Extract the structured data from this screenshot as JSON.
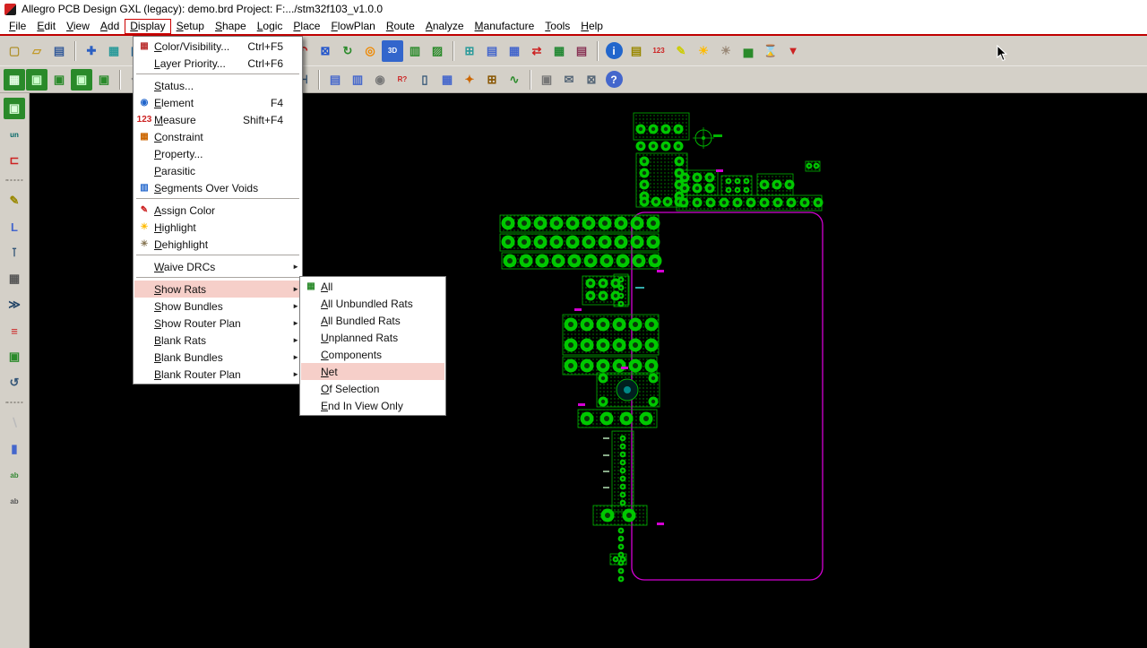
{
  "window": {
    "title": "Allegro PCB Design GXL (legacy): demo.brd  Project: F:.../stm32f103_v1.0.0"
  },
  "menubar": {
    "items": [
      {
        "label": "File",
        "name": "menu-file"
      },
      {
        "label": "Edit",
        "name": "menu-edit"
      },
      {
        "label": "View",
        "name": "menu-view"
      },
      {
        "label": "Add",
        "name": "menu-add"
      },
      {
        "label": "Display",
        "name": "menu-display",
        "cls": "active"
      },
      {
        "label": "Setup",
        "name": "menu-setup"
      },
      {
        "label": "Shape",
        "name": "menu-shape"
      },
      {
        "label": "Logic",
        "name": "menu-logic"
      },
      {
        "label": "Place",
        "name": "menu-place"
      },
      {
        "label": "FlowPlan",
        "name": "menu-flowplan"
      },
      {
        "label": "Route",
        "name": "menu-route"
      },
      {
        "label": "Analyze",
        "name": "menu-analyze"
      },
      {
        "label": "Manufacture",
        "name": "menu-manufacture"
      },
      {
        "label": "Tools",
        "name": "menu-tools"
      },
      {
        "label": "Help",
        "name": "menu-help"
      }
    ]
  },
  "toolbar_main": {
    "icons": [
      {
        "name": "new-icon",
        "glyph": "▢",
        "fg": "#b0922f"
      },
      {
        "name": "open-folder-icon",
        "glyph": "▱",
        "fg": "#c29a2a"
      },
      {
        "name": "save-icon",
        "glyph": "▤",
        "fg": "#335a99"
      },
      {
        "name": "toolbar-separator",
        "cls": "sep"
      },
      {
        "name": "move-icon",
        "glyph": "✚",
        "fg": "#2b5fc2"
      },
      {
        "name": "show-rats-icon",
        "glyph": "▦",
        "fg": "#2a9a9a"
      },
      {
        "name": "shadow-toggle-icon",
        "glyph": "◫",
        "fg": "#2a6a9a"
      },
      {
        "name": "blank-rats-icon",
        "glyph": "▩",
        "fg": "#777777"
      },
      {
        "name": "toolbar-separator",
        "cls": "sep"
      },
      {
        "name": "zoom-points-icon",
        "glyph": "⊙",
        "fg": "#2255cc"
      },
      {
        "name": "zoom-fit-icon",
        "glyph": "⊡",
        "fg": "#2255cc"
      },
      {
        "name": "zoom-in-icon",
        "glyph": "⊕",
        "fg": "#2255cc"
      },
      {
        "name": "zoom-out-icon",
        "glyph": "⊖",
        "fg": "#2255cc"
      },
      {
        "name": "zoom-world-icon",
        "glyph": "◎",
        "fg": "#2255cc"
      },
      {
        "name": "zoom-previous-icon",
        "glyph": "↶",
        "fg": "#cc2222"
      },
      {
        "name": "zoom-selection-icon",
        "glyph": "⊠",
        "fg": "#2255cc"
      },
      {
        "name": "redraw-icon",
        "glyph": "↻",
        "fg": "#2a8a2a"
      },
      {
        "name": "target-icon",
        "glyph": "◎",
        "fg": "#ee8800"
      },
      {
        "name": "3d-view-icon",
        "glyph": "3D",
        "fg": "#ffffff",
        "bg": "#3366cc",
        "cls": "small"
      },
      {
        "name": "film-icon",
        "glyph": "▥",
        "fg": "#2a8a2a"
      },
      {
        "name": "artwork-icon",
        "glyph": "▨",
        "fg": "#2a8a2a"
      },
      {
        "name": "toolbar-separator",
        "cls": "sep"
      },
      {
        "name": "grid-icon",
        "glyph": "⊞",
        "fg": "#2a9a9a"
      },
      {
        "name": "property-icon",
        "glyph": "▤",
        "fg": "#4466cc"
      },
      {
        "name": "constraint-manager-icon",
        "glyph": "▦",
        "fg": "#4466cc"
      },
      {
        "name": "swap-icon",
        "glyph": "⇄",
        "fg": "#cc2222"
      },
      {
        "name": "spreadsheet-icon",
        "glyph": "▦",
        "fg": "#228833"
      },
      {
        "name": "cross-section-icon",
        "glyph": "▤",
        "fg": "#883355"
      },
      {
        "name": "toolbar-separator",
        "cls": "sep"
      },
      {
        "name": "info-icon",
        "glyph": "i",
        "fg": "#ffffff",
        "bg": "#2266cc",
        "cls": "round"
      },
      {
        "name": "report-icon",
        "glyph": "▤",
        "fg": "#998800"
      },
      {
        "name": "measure-123-icon",
        "glyph": "123",
        "fg": "#cc2222",
        "cls": "small"
      },
      {
        "name": "highlight-pen-icon",
        "glyph": "✎",
        "fg": "#cccc00"
      },
      {
        "name": "highlight-icon",
        "glyph": "☀",
        "fg": "#ffbb00"
      },
      {
        "name": "dehighlight-icon",
        "glyph": "☀",
        "fg": "#998877"
      },
      {
        "name": "bar-chart-icon",
        "glyph": "▅",
        "fg": "#2a8a2a"
      },
      {
        "name": "hourglass-icon",
        "glyph": "⌛",
        "fg": "#2a9a9a"
      },
      {
        "name": "filter-rats-icon",
        "glyph": "▼",
        "fg": "#cc2222"
      }
    ]
  },
  "toolbar_secondary": {
    "icons": [
      {
        "name": "color192-icon",
        "glyph": "▦",
        "fg": "#e6ffe6",
        "bg": "#2a8a2a"
      },
      {
        "name": "visibility-save1-icon",
        "glyph": "▣",
        "fg": "#ccffcc",
        "bg": "#2a8a2a"
      },
      {
        "name": "visibility-save2-icon",
        "glyph": "▣",
        "fg": "#2a8a2a"
      },
      {
        "name": "visibility-save3-icon",
        "glyph": "▣",
        "fg": "#ccffcc",
        "bg": "#2a8a2a"
      },
      {
        "name": "visibility-save4-icon",
        "glyph": "▣",
        "fg": "#2a8a2a"
      },
      {
        "name": "toolbar-separator",
        "cls": "sep"
      },
      {
        "name": "prev-shape-icon",
        "glyph": "↶",
        "fg": "#888888"
      },
      {
        "name": "rect-shape-icon",
        "glyph": "▭",
        "fg": "#888888"
      },
      {
        "name": "circle-shape-icon",
        "glyph": "◯",
        "fg": "#888888"
      },
      {
        "name": "poly-shape-icon",
        "glyph": "▱",
        "fg": "#888888"
      },
      {
        "name": "delete-icon",
        "glyph": "✖",
        "fg": "#cc2222"
      },
      {
        "name": "toolbar-separator",
        "cls": "sep"
      },
      {
        "name": "component-icon",
        "glyph": "▣",
        "fg": "#ddffdd",
        "bg": "#2a8a2a"
      },
      {
        "name": "dim-horizontal-icon",
        "glyph": "⊢",
        "fg": "#335577"
      },
      {
        "name": "dim-vertical-icon",
        "glyph": "⊣",
        "fg": "#335577"
      },
      {
        "name": "toolbar-separator",
        "cls": "sep"
      },
      {
        "name": "film-record-icon",
        "glyph": "▤",
        "fg": "#4466cc"
      },
      {
        "name": "module-icon",
        "glyph": "▥",
        "fg": "#4466cc"
      },
      {
        "name": "probe-icon",
        "glyph": "◉",
        "fg": "#777777"
      },
      {
        "name": "refdes-icon",
        "glyph": "R?",
        "fg": "#cc2222",
        "cls": "small"
      },
      {
        "name": "panel-icon",
        "glyph": "▯",
        "fg": "#335577"
      },
      {
        "name": "checker-icon",
        "glyph": "▦",
        "fg": "#4466cc"
      },
      {
        "name": "glue-icon",
        "glyph": "✦",
        "fg": "#cc6600"
      },
      {
        "name": "snap-grid-icon",
        "glyph": "⊞",
        "fg": "#885500"
      },
      {
        "name": "waveform-icon",
        "glyph": "∿",
        "fg": "#2a8a2a"
      },
      {
        "name": "toolbar-separator",
        "cls": "sep"
      },
      {
        "name": "copy-view-icon",
        "glyph": "▣",
        "fg": "#777777"
      },
      {
        "name": "mail-send-icon",
        "glyph": "✉",
        "fg": "#556677"
      },
      {
        "name": "mail-x-icon",
        "glyph": "⊠",
        "fg": "#556677"
      },
      {
        "name": "help-icon",
        "glyph": "?",
        "fg": "#ffffff",
        "bg": "#4466cc",
        "cls": "round"
      }
    ]
  },
  "sidebar": {
    "icons": [
      {
        "name": "visibility-board-icon",
        "glyph": "▣",
        "fg": "#ddffdd",
        "bg": "#2a8a2a"
      },
      {
        "name": "unrats-icon",
        "glyph": "un",
        "fg": "#006666",
        "cls": "small"
      },
      {
        "name": "connector-icon",
        "glyph": "⊏",
        "fg": "#cc2222"
      },
      {
        "name": "sidebar-grip",
        "cls": "grip"
      },
      {
        "name": "pencil-tool-icon",
        "glyph": "✎",
        "fg": "#998800"
      },
      {
        "name": "label-tool-icon",
        "glyph": "L",
        "fg": "#4466cc"
      },
      {
        "name": "pin-tool-icon",
        "glyph": "⊺",
        "fg": "#335577"
      },
      {
        "name": "crop-tool-icon",
        "glyph": "▦",
        "fg": "#555555"
      },
      {
        "name": "fast-forward-icon",
        "glyph": "≫",
        "fg": "#224466"
      },
      {
        "name": "etch-edit-icon",
        "glyph": "≡",
        "fg": "#cc2222"
      },
      {
        "name": "board-small-icon",
        "glyph": "▣",
        "fg": "#2a8a2a"
      },
      {
        "name": "rotate-icon",
        "glyph": "↺",
        "fg": "#335577"
      },
      {
        "name": "sidebar-grip",
        "cls": "grip"
      },
      {
        "name": "line-tool-icon",
        "glyph": "∖",
        "fg": "#bbbbbb"
      },
      {
        "name": "rect-tool-icon",
        "glyph": "▮",
        "fg": "#4466cc"
      },
      {
        "name": "add-text-icon",
        "glyph": "ab",
        "fg": "#338833",
        "cls": "small"
      },
      {
        "name": "edit-text-icon",
        "glyph": "ab",
        "fg": "#555555",
        "cls": "small"
      }
    ]
  },
  "display_menu": {
    "items": [
      {
        "name": "menu-item-color-visibility",
        "label": "Color/Visibility...",
        "shortcut": "Ctrl+F5",
        "glyph": "▦",
        "fg": "#bb3333"
      },
      {
        "name": "menu-item-layer-priority",
        "label": "Layer Priority...",
        "shortcut": "Ctrl+F6"
      },
      {
        "name": "menu-separator",
        "cls": "sep"
      },
      {
        "name": "menu-item-status",
        "label": "Status..."
      },
      {
        "name": "menu-item-element",
        "label": "Element",
        "shortcut": "F4",
        "glyph": "◉",
        "fg": "#2266cc"
      },
      {
        "name": "menu-item-measure",
        "label": "Measure",
        "shortcut": "Shift+F4",
        "glyph": "123",
        "fg": "#cc2222"
      },
      {
        "name": "menu-item-constraint",
        "label": "Constraint",
        "glyph": "▦",
        "fg": "#cc6600"
      },
      {
        "name": "menu-item-property",
        "label": "Property..."
      },
      {
        "name": "menu-item-parasitic",
        "label": "Parasitic"
      },
      {
        "name": "menu-item-segments-over-voids",
        "label": "Segments Over Voids",
        "glyph": "▥",
        "fg": "#2266cc"
      },
      {
        "name": "menu-separator",
        "cls": "sep"
      },
      {
        "name": "menu-item-assign-color",
        "label": "Assign Color",
        "glyph": "✎",
        "fg": "#cc2222"
      },
      {
        "name": "menu-item-highlight",
        "label": "Highlight",
        "glyph": "☀",
        "fg": "#ffbb00"
      },
      {
        "name": "menu-item-dehighlight",
        "label": "Dehighlight",
        "glyph": "☀",
        "fg": "#887755"
      },
      {
        "name": "menu-separator",
        "cls": "sep"
      },
      {
        "name": "menu-item-waive-drcs",
        "label": "Waive DRCs",
        "arrow": "►"
      },
      {
        "name": "menu-separator",
        "cls": "sep"
      },
      {
        "name": "menu-item-show-rats",
        "label": "Show Rats",
        "arrow": "►",
        "cls": "hl"
      },
      {
        "name": "menu-item-show-bundles",
        "label": "Show Bundles",
        "arrow": "►"
      },
      {
        "name": "menu-item-show-router-plan",
        "label": "Show Router Plan",
        "arrow": "►"
      },
      {
        "name": "menu-item-blank-rats",
        "label": "Blank Rats",
        "arrow": "►"
      },
      {
        "name": "menu-item-blank-bundles",
        "label": "Blank Bundles",
        "arrow": "►"
      },
      {
        "name": "menu-item-blank-router-plan",
        "label": "Blank Router Plan",
        "arrow": "►"
      }
    ]
  },
  "show_rats_submenu": {
    "items": [
      {
        "name": "menu-item-rats-all",
        "label": "All",
        "glyph": "▦",
        "fg": "#2a8a2a"
      },
      {
        "name": "menu-item-rats-all-unbundled",
        "label": "All Unbundled Rats"
      },
      {
        "name": "menu-item-rats-all-bundled",
        "label": "All Bundled Rats"
      },
      {
        "name": "menu-item-rats-unplanned",
        "label": "Unplanned Rats"
      },
      {
        "name": "menu-item-rats-components",
        "label": "Components"
      },
      {
        "name": "menu-item-rats-net",
        "label": "Net",
        "cls": "hl"
      },
      {
        "name": "menu-item-rats-of-selection",
        "label": "Of Selection"
      },
      {
        "name": "menu-item-rats-end-in-view",
        "label": "End In View Only"
      }
    ]
  },
  "colors": {
    "canvas_bg": "#000000",
    "toolbar_bg": "#d4d0c8",
    "board_outline": "#d400d4",
    "pad_green": "#00c800",
    "menu_highlight": "#f6cfc9",
    "menubar_active_border": "#cc0000",
    "accent_red_line": "#c00000"
  }
}
